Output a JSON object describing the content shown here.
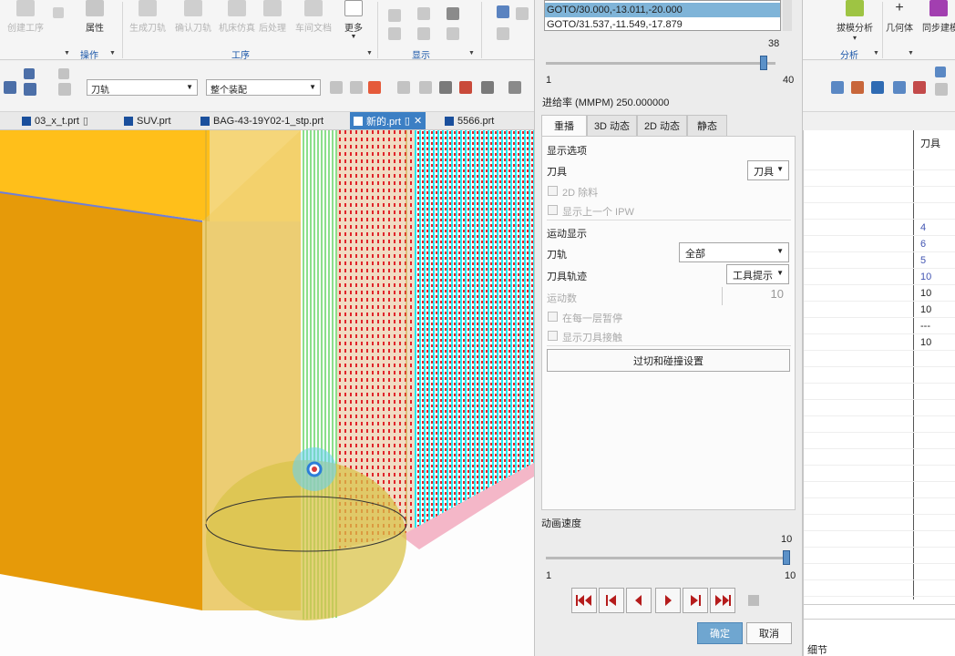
{
  "ribbon": {
    "create_op": "创建工序",
    "properties": "属性",
    "operations_group": "操作",
    "generate_path": "生成刀轨",
    "verify_path": "确认刀轨",
    "machine_sim": "机床仿真",
    "postprocess": "后处理",
    "shop_doc": "车间文档",
    "more": "更多",
    "process_group": "工序",
    "display_group": "显示",
    "draft_analysis": "拔模分析",
    "draft_analysis_arrow": "▾",
    "geometry": "几何体",
    "sync_modeling": "同步建模",
    "analysis_group": "分析"
  },
  "toolbar": {
    "filter_path": "刀轨",
    "filter_scope": "整个装配"
  },
  "file_tabs": [
    {
      "label": "03_x_t.prt",
      "active": false
    },
    {
      "label": "SUV.prt",
      "active": false
    },
    {
      "label": "BAG-43-19Y02-1_stp.prt",
      "active": false
    },
    {
      "label": "新的.prt",
      "active": true
    },
    {
      "label": "5566.prt",
      "active": false
    }
  ],
  "dialog": {
    "list_items": [
      "GOTO/30.000,-13.011,-20.000",
      "GOTO/31.537,-11.549,-17.879"
    ],
    "selected_index": 0,
    "motion_slider": {
      "value": 38,
      "min": 1,
      "max": 40,
      "current_label": "38",
      "min_label": "1",
      "max_label": "40"
    },
    "feed_rate_label": "进给率 (MMPM) 250.000000",
    "tabs": [
      "重播",
      "3D 动态",
      "2D 动态",
      "静态"
    ],
    "active_tab": 0,
    "display_options": "显示选项",
    "tool_label": "刀具",
    "tool_value": "刀具",
    "cb_2d_remove": "2D 除料",
    "cb_show_ipw": "显示上一个 IPW",
    "motion_display": "运动显示",
    "path_label": "刀轨",
    "path_value": "全部",
    "tool_trace_label": "刀具轨迹",
    "tool_trace_value": "工具提示",
    "motion_count_label": "运动数",
    "motion_count_value": "10",
    "cb_pause_layer": "在每一层暂停",
    "cb_show_contact": "显示刀具接触",
    "gouge_button": "过切和碰撞设置",
    "anim_speed_label": "动画速度",
    "speed_slider": {
      "value": 10,
      "min": 1,
      "max": 10,
      "current_label": "10",
      "min_label": "1",
      "max_label": "10"
    },
    "ok": "确定",
    "cancel": "取消"
  },
  "right_panel": {
    "header": "刀具",
    "values": [
      "",
      "",
      "",
      "",
      "4",
      "6",
      "5",
      "10",
      "10",
      "10",
      "---",
      "10"
    ],
    "bottom_text": "细节"
  },
  "colors": {
    "accent": "#3c7fc4",
    "selection": "#7fb4d8",
    "ok_button": "#6fa6d0",
    "part_orange": "#ffa500",
    "path_red": "#e0242a",
    "path_cyan": "#27e8ef",
    "path_green": "#6fd76e"
  },
  "icons": [
    "create-op-icon",
    "properties-icon",
    "generate-path-icon",
    "verify-icon",
    "machine-sim-icon",
    "postprocess-icon",
    "shop-doc-icon",
    "more-icon",
    "draft-analysis-icon",
    "geometry-icon",
    "sync-icon",
    "first-icon",
    "step-back-icon",
    "play-back-icon",
    "play-icon",
    "step-forward-icon",
    "last-icon",
    "stop-icon"
  ]
}
